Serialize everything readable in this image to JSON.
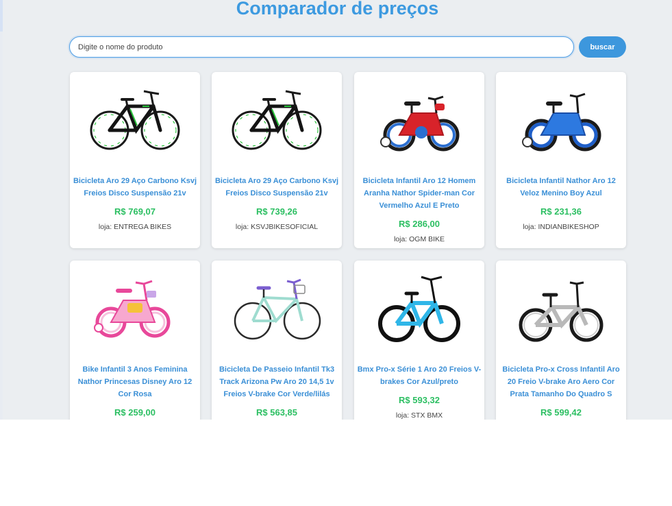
{
  "header": {
    "title": "Comparador de preços"
  },
  "search": {
    "placeholder": "Digite o nome do produto",
    "button_label": "buscar"
  },
  "products": [
    {
      "title": "Bicicleta Aro 29 Aço Carbono Ksvj Freios Disco Suspensão 21v",
      "price": "R$ 769,07",
      "store": "loja: ENTREGA BIKES",
      "image": "mtb-black-green"
    },
    {
      "title": "Bicicleta Aro 29 Aço Carbono Ksvj Freios Disco Suspensão 21v",
      "price": "R$ 739,26",
      "store": "loja: KSVJBIKESOFICIAL",
      "image": "mtb-black-green"
    },
    {
      "title": "Bicicleta Infantil Aro 12 Homem Aranha Nathor Spider-man Cor Vermelho Azul E Preto",
      "price": "R$ 286,00",
      "store": "loja: OGM BIKE",
      "image": "kids-red-blue"
    },
    {
      "title": "Bicicleta Infantil Nathor Aro 12 Veloz Menino Boy Azul",
      "price": "R$ 231,36",
      "store": "loja: INDIANBIKESHOP",
      "image": "kids-blue"
    },
    {
      "title": "Bike Infantil 3 Anos Feminina Nathor Princesas Disney Aro 12 Cor Rosa",
      "price": "R$ 259,00",
      "store": "",
      "image": "kids-pink"
    },
    {
      "title": "Bicicleta De Passeio Infantil Tk3 Track Arizona Pw Aro 20 14,5 1v Freios V-brake Cor Verde/lilás",
      "price": "R$ 563,85",
      "store": "",
      "image": "city-mint"
    },
    {
      "title": "Bmx Pro-x Série 1 Aro 20 Freios V-brakes Cor Azul/preto",
      "price": "R$ 593,32",
      "store": "loja: STX BMX",
      "image": "bmx-blue"
    },
    {
      "title": "Bicicleta Pro-x Cross Infantil Aro 20 Freio V-brake Aro Aero Cor Prata Tamanho Do Quadro S",
      "price": "R$ 599,42",
      "store": "",
      "image": "bmx-silver"
    }
  ],
  "colors": {
    "accent": "#3d9ae0",
    "price": "#2cbf62",
    "background": "#ebeef1"
  }
}
